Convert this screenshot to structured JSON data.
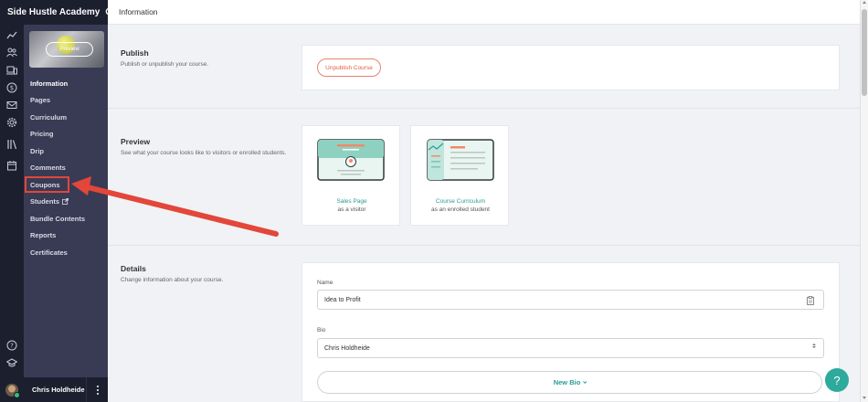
{
  "sidebar": {
    "school_name": "Side Hustle Academy",
    "preview_label": "Preview",
    "items": [
      {
        "label": "Information",
        "active": true
      },
      {
        "label": "Pages"
      },
      {
        "label": "Curriculum"
      },
      {
        "label": "Pricing"
      },
      {
        "label": "Drip"
      },
      {
        "label": "Comments"
      },
      {
        "label": "Coupons",
        "highlighted": true
      },
      {
        "label": "Students",
        "external": true
      },
      {
        "label": "Bundle Contents"
      },
      {
        "label": "Reports"
      },
      {
        "label": "Certificates"
      }
    ],
    "rail_icons": [
      "stats-icon",
      "users-icon",
      "sites-icon",
      "sales-icon",
      "mail-icon",
      "settings-icon",
      "library-icon",
      "calendar-icon",
      "help-circle-icon",
      "graduation-cap-icon"
    ],
    "user_name": "Chris Holdheide"
  },
  "header": {
    "title": "Information"
  },
  "publish": {
    "title": "Publish",
    "description": "Publish or unpublish your course.",
    "button_label": "Unpublish Course"
  },
  "preview": {
    "title": "Preview",
    "description": "See what your course looks like to visitors or enrolled students.",
    "cards": [
      {
        "link": "Sales Page",
        "sub": "as a visitor"
      },
      {
        "link": "Course Curriculum",
        "sub": "as an enrolled student"
      }
    ]
  },
  "details": {
    "title": "Details",
    "description": "Change information about your course.",
    "name_label": "Name",
    "name_value": "Idea to Profit",
    "bio_label": "Bio",
    "bio_value": "Chris Holdheide",
    "new_bio_label": "New Bio"
  },
  "help": {
    "label": "?"
  },
  "colors": {
    "rail": "#1c1f2e",
    "nav": "#393b55",
    "accent": "#2a9d8f",
    "annotation": "#e3463a",
    "unpublish": "#e15f43"
  }
}
